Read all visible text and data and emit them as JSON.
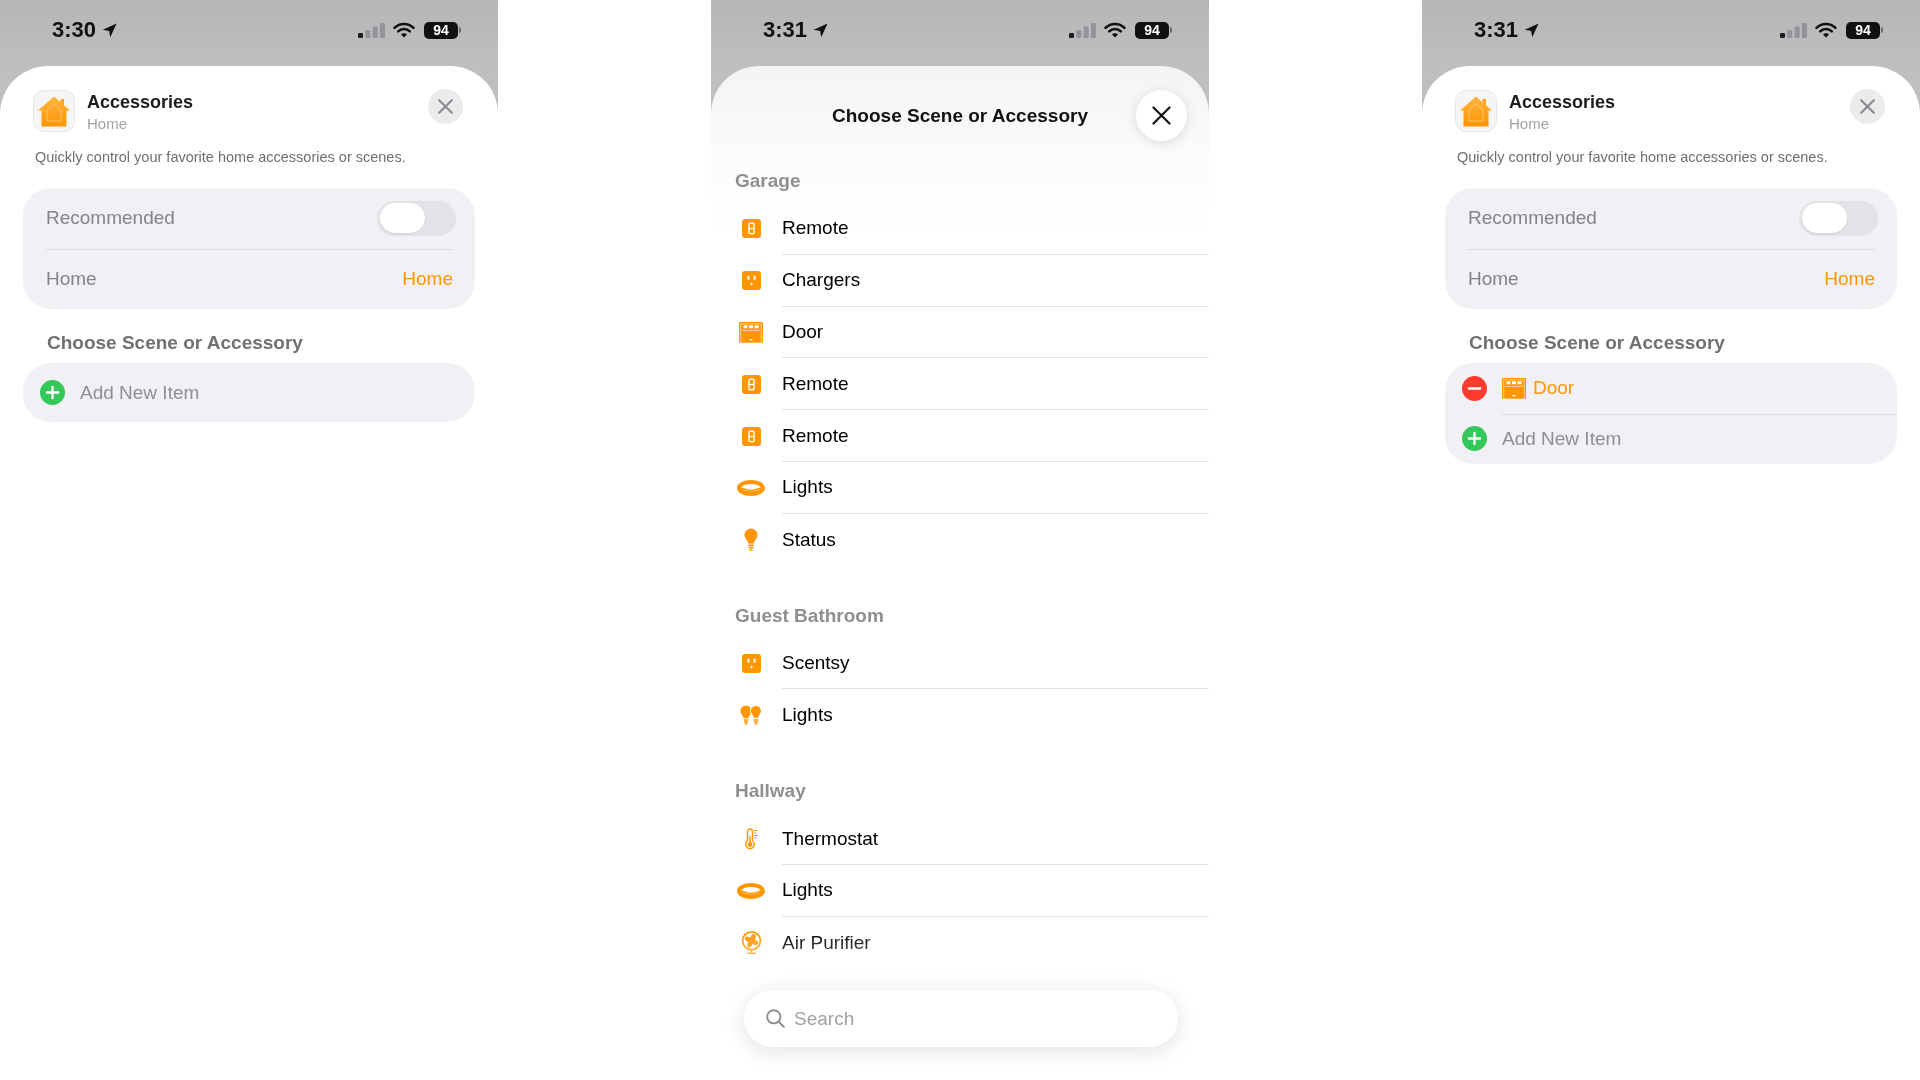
{
  "screens": [
    {
      "kind": "widget_settings",
      "status_bar": {
        "time": "3:30",
        "battery": "94"
      },
      "app": {
        "title": "Accessories",
        "subtitle": "Home"
      },
      "description": "Quickly control your favorite home accessories or scenes.",
      "settings": [
        {
          "kind": "toggle",
          "label": "Recommended",
          "on": false
        },
        {
          "kind": "picker",
          "label": "Home",
          "value": "Home"
        }
      ],
      "section_title": "Choose Scene or Accessory",
      "items": [
        {
          "kind": "add",
          "label": "Add New Item"
        }
      ]
    },
    {
      "kind": "accessory_picker",
      "status_bar": {
        "time": "3:31",
        "battery": "94"
      },
      "title": "Choose Scene or Accessory",
      "groups": [
        {
          "title": "Garage",
          "items": [
            {
              "kind": "remote",
              "label": "Remote"
            },
            {
              "kind": "outlet",
              "label": "Chargers"
            },
            {
              "kind": "garage_door",
              "label": "Door"
            },
            {
              "kind": "remote",
              "label": "Remote"
            },
            {
              "kind": "remote",
              "label": "Remote"
            },
            {
              "kind": "ceiling_light",
              "label": "Lights"
            },
            {
              "kind": "bulb",
              "label": "Status"
            }
          ]
        },
        {
          "title": "Guest Bathroom",
          "items": [
            {
              "kind": "outlet",
              "label": "Scentsy"
            },
            {
              "kind": "bulbs",
              "label": "Lights"
            }
          ]
        },
        {
          "title": "Hallway",
          "items": [
            {
              "kind": "thermostat",
              "label": "Thermostat"
            },
            {
              "kind": "ceiling_light",
              "label": "Lights"
            },
            {
              "kind": "fan",
              "label": "Air Purifier"
            }
          ]
        }
      ],
      "search": {
        "placeholder": "Search"
      }
    },
    {
      "kind": "widget_settings",
      "status_bar": {
        "time": "3:31",
        "battery": "94"
      },
      "app": {
        "title": "Accessories",
        "subtitle": "Home"
      },
      "description": "Quickly control your favorite home accessories or scenes.",
      "settings": [
        {
          "kind": "toggle",
          "label": "Recommended",
          "on": false
        },
        {
          "kind": "picker",
          "label": "Home",
          "value": "Home"
        }
      ],
      "section_title": "Choose Scene or Accessory",
      "items": [
        {
          "kind": "garage_door",
          "label": "Door"
        },
        {
          "kind": "add",
          "label": "Add New Item"
        }
      ]
    }
  ]
}
